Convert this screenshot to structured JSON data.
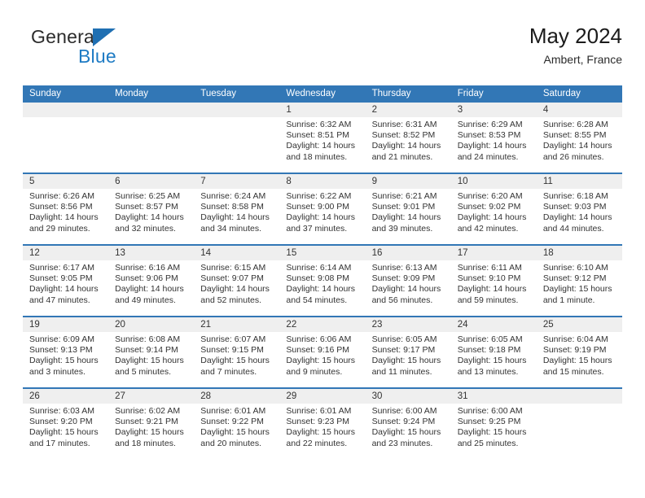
{
  "logo": {
    "text_primary": "General",
    "text_secondary": "Blue",
    "icon": "triangle-icon",
    "color_primary": "#2b2b2b",
    "color_secondary": "#1e7bc4"
  },
  "header": {
    "title": "May 2024",
    "subtitle": "Ambert, France"
  },
  "theme": {
    "header_blue": "#3277b6",
    "day_band_gray": "#efefef",
    "text": "#333333"
  },
  "calendar": {
    "weekdays": [
      "Sunday",
      "Monday",
      "Tuesday",
      "Wednesday",
      "Thursday",
      "Friday",
      "Saturday"
    ],
    "weeks": [
      [
        {
          "day": "",
          "empty": true
        },
        {
          "day": "",
          "empty": true
        },
        {
          "day": "",
          "empty": true
        },
        {
          "day": "1",
          "sunrise": "Sunrise: 6:32 AM",
          "sunset": "Sunset: 8:51 PM",
          "daylight1": "Daylight: 14 hours",
          "daylight2": "and 18 minutes."
        },
        {
          "day": "2",
          "sunrise": "Sunrise: 6:31 AM",
          "sunset": "Sunset: 8:52 PM",
          "daylight1": "Daylight: 14 hours",
          "daylight2": "and 21 minutes."
        },
        {
          "day": "3",
          "sunrise": "Sunrise: 6:29 AM",
          "sunset": "Sunset: 8:53 PM",
          "daylight1": "Daylight: 14 hours",
          "daylight2": "and 24 minutes."
        },
        {
          "day": "4",
          "sunrise": "Sunrise: 6:28 AM",
          "sunset": "Sunset: 8:55 PM",
          "daylight1": "Daylight: 14 hours",
          "daylight2": "and 26 minutes."
        }
      ],
      [
        {
          "day": "5",
          "sunrise": "Sunrise: 6:26 AM",
          "sunset": "Sunset: 8:56 PM",
          "daylight1": "Daylight: 14 hours",
          "daylight2": "and 29 minutes."
        },
        {
          "day": "6",
          "sunrise": "Sunrise: 6:25 AM",
          "sunset": "Sunset: 8:57 PM",
          "daylight1": "Daylight: 14 hours",
          "daylight2": "and 32 minutes."
        },
        {
          "day": "7",
          "sunrise": "Sunrise: 6:24 AM",
          "sunset": "Sunset: 8:58 PM",
          "daylight1": "Daylight: 14 hours",
          "daylight2": "and 34 minutes."
        },
        {
          "day": "8",
          "sunrise": "Sunrise: 6:22 AM",
          "sunset": "Sunset: 9:00 PM",
          "daylight1": "Daylight: 14 hours",
          "daylight2": "and 37 minutes."
        },
        {
          "day": "9",
          "sunrise": "Sunrise: 6:21 AM",
          "sunset": "Sunset: 9:01 PM",
          "daylight1": "Daylight: 14 hours",
          "daylight2": "and 39 minutes."
        },
        {
          "day": "10",
          "sunrise": "Sunrise: 6:20 AM",
          "sunset": "Sunset: 9:02 PM",
          "daylight1": "Daylight: 14 hours",
          "daylight2": "and 42 minutes."
        },
        {
          "day": "11",
          "sunrise": "Sunrise: 6:18 AM",
          "sunset": "Sunset: 9:03 PM",
          "daylight1": "Daylight: 14 hours",
          "daylight2": "and 44 minutes."
        }
      ],
      [
        {
          "day": "12",
          "sunrise": "Sunrise: 6:17 AM",
          "sunset": "Sunset: 9:05 PM",
          "daylight1": "Daylight: 14 hours",
          "daylight2": "and 47 minutes."
        },
        {
          "day": "13",
          "sunrise": "Sunrise: 6:16 AM",
          "sunset": "Sunset: 9:06 PM",
          "daylight1": "Daylight: 14 hours",
          "daylight2": "and 49 minutes."
        },
        {
          "day": "14",
          "sunrise": "Sunrise: 6:15 AM",
          "sunset": "Sunset: 9:07 PM",
          "daylight1": "Daylight: 14 hours",
          "daylight2": "and 52 minutes."
        },
        {
          "day": "15",
          "sunrise": "Sunrise: 6:14 AM",
          "sunset": "Sunset: 9:08 PM",
          "daylight1": "Daylight: 14 hours",
          "daylight2": "and 54 minutes."
        },
        {
          "day": "16",
          "sunrise": "Sunrise: 6:13 AM",
          "sunset": "Sunset: 9:09 PM",
          "daylight1": "Daylight: 14 hours",
          "daylight2": "and 56 minutes."
        },
        {
          "day": "17",
          "sunrise": "Sunrise: 6:11 AM",
          "sunset": "Sunset: 9:10 PM",
          "daylight1": "Daylight: 14 hours",
          "daylight2": "and 59 minutes."
        },
        {
          "day": "18",
          "sunrise": "Sunrise: 6:10 AM",
          "sunset": "Sunset: 9:12 PM",
          "daylight1": "Daylight: 15 hours",
          "daylight2": "and 1 minute."
        }
      ],
      [
        {
          "day": "19",
          "sunrise": "Sunrise: 6:09 AM",
          "sunset": "Sunset: 9:13 PM",
          "daylight1": "Daylight: 15 hours",
          "daylight2": "and 3 minutes."
        },
        {
          "day": "20",
          "sunrise": "Sunrise: 6:08 AM",
          "sunset": "Sunset: 9:14 PM",
          "daylight1": "Daylight: 15 hours",
          "daylight2": "and 5 minutes."
        },
        {
          "day": "21",
          "sunrise": "Sunrise: 6:07 AM",
          "sunset": "Sunset: 9:15 PM",
          "daylight1": "Daylight: 15 hours",
          "daylight2": "and 7 minutes."
        },
        {
          "day": "22",
          "sunrise": "Sunrise: 6:06 AM",
          "sunset": "Sunset: 9:16 PM",
          "daylight1": "Daylight: 15 hours",
          "daylight2": "and 9 minutes."
        },
        {
          "day": "23",
          "sunrise": "Sunrise: 6:05 AM",
          "sunset": "Sunset: 9:17 PM",
          "daylight1": "Daylight: 15 hours",
          "daylight2": "and 11 minutes."
        },
        {
          "day": "24",
          "sunrise": "Sunrise: 6:05 AM",
          "sunset": "Sunset: 9:18 PM",
          "daylight1": "Daylight: 15 hours",
          "daylight2": "and 13 minutes."
        },
        {
          "day": "25",
          "sunrise": "Sunrise: 6:04 AM",
          "sunset": "Sunset: 9:19 PM",
          "daylight1": "Daylight: 15 hours",
          "daylight2": "and 15 minutes."
        }
      ],
      [
        {
          "day": "26",
          "sunrise": "Sunrise: 6:03 AM",
          "sunset": "Sunset: 9:20 PM",
          "daylight1": "Daylight: 15 hours",
          "daylight2": "and 17 minutes."
        },
        {
          "day": "27",
          "sunrise": "Sunrise: 6:02 AM",
          "sunset": "Sunset: 9:21 PM",
          "daylight1": "Daylight: 15 hours",
          "daylight2": "and 18 minutes."
        },
        {
          "day": "28",
          "sunrise": "Sunrise: 6:01 AM",
          "sunset": "Sunset: 9:22 PM",
          "daylight1": "Daylight: 15 hours",
          "daylight2": "and 20 minutes."
        },
        {
          "day": "29",
          "sunrise": "Sunrise: 6:01 AM",
          "sunset": "Sunset: 9:23 PM",
          "daylight1": "Daylight: 15 hours",
          "daylight2": "and 22 minutes."
        },
        {
          "day": "30",
          "sunrise": "Sunrise: 6:00 AM",
          "sunset": "Sunset: 9:24 PM",
          "daylight1": "Daylight: 15 hours",
          "daylight2": "and 23 minutes."
        },
        {
          "day": "31",
          "sunrise": "Sunrise: 6:00 AM",
          "sunset": "Sunset: 9:25 PM",
          "daylight1": "Daylight: 15 hours",
          "daylight2": "and 25 minutes."
        },
        {
          "day": "",
          "empty": true
        }
      ]
    ]
  }
}
